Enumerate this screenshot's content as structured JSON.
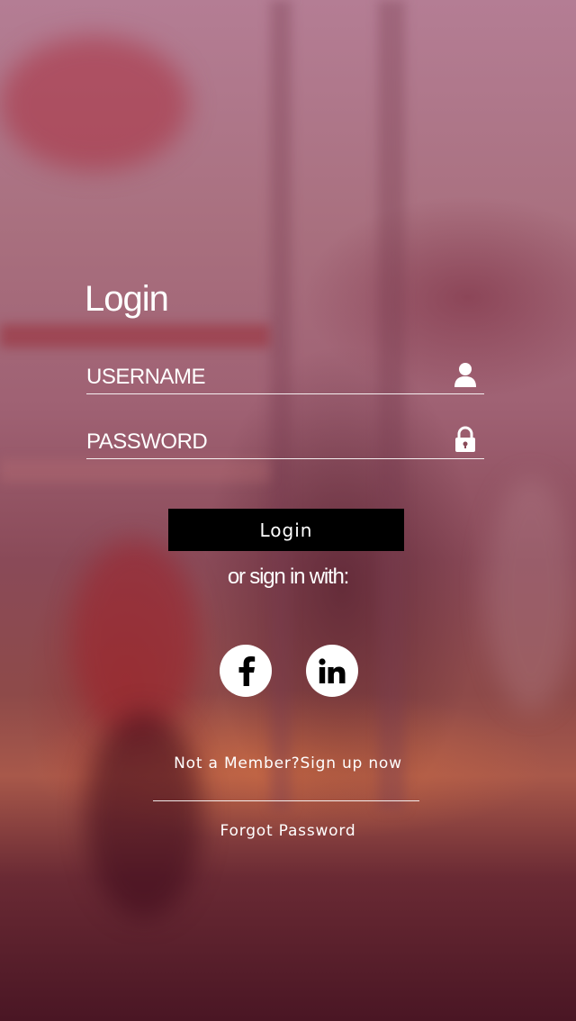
{
  "login": {
    "title": "Login",
    "username_placeholder": "USERNAME",
    "password_placeholder": "PASSWORD",
    "button_label": "Login",
    "or_text": "or sign in with:",
    "signup_text": "Not a Member?Sign up now",
    "forgot_text": "Forgot Password"
  },
  "icons": {
    "username": "user-icon",
    "password": "lock-icon",
    "facebook": "facebook-icon",
    "linkedin": "linkedin-icon"
  },
  "colors": {
    "button_bg": "#000000",
    "text": "#ffffff",
    "social_bg": "#ffffff"
  }
}
